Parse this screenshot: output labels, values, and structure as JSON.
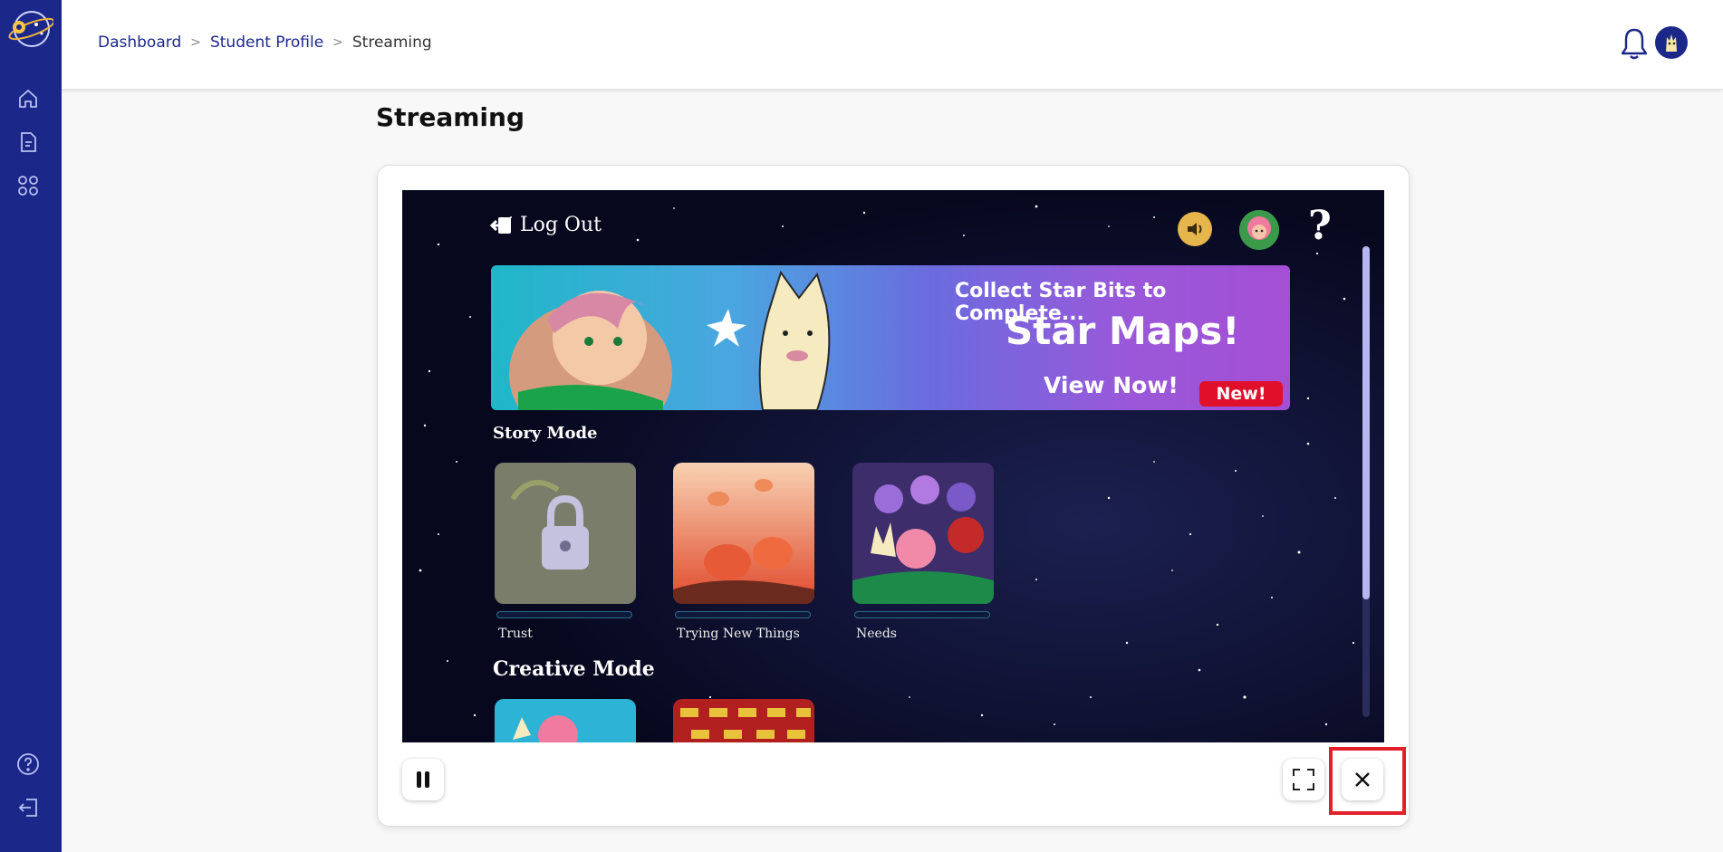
{
  "breadcrumb": {
    "items": [
      "Dashboard",
      "Student Profile"
    ],
    "separator": ">",
    "current": "Streaming"
  },
  "page": {
    "title": "Streaming"
  },
  "sidebar": {
    "logo": "planet-logo",
    "nav": [
      "home-icon",
      "document-icon",
      "apps-grid-icon"
    ],
    "bottom": [
      "help-icon",
      "logout-icon"
    ]
  },
  "header": {
    "icons": [
      "bell-icon",
      "user-avatar"
    ]
  },
  "game": {
    "logout_label": "Log Out",
    "banner": {
      "line1": "Collect Star Bits to Complete...",
      "line2": "Star Maps!",
      "line3": "View Now!",
      "badge": "New!"
    },
    "story_mode": {
      "title": "Story Mode",
      "tiles": [
        {
          "label": "Trust",
          "locked": true
        },
        {
          "label": "Trying New Things",
          "locked": false
        },
        {
          "label": "Needs",
          "locked": false
        }
      ]
    },
    "creative_mode": {
      "title": "Creative Mode"
    }
  },
  "controls": {
    "pause": "pause-icon",
    "fullscreen": "fullscreen-icon",
    "close": "close-icon"
  },
  "colors": {
    "sidebar": "#1c2889",
    "link": "#1c2889",
    "highlight": "#e3202a"
  }
}
